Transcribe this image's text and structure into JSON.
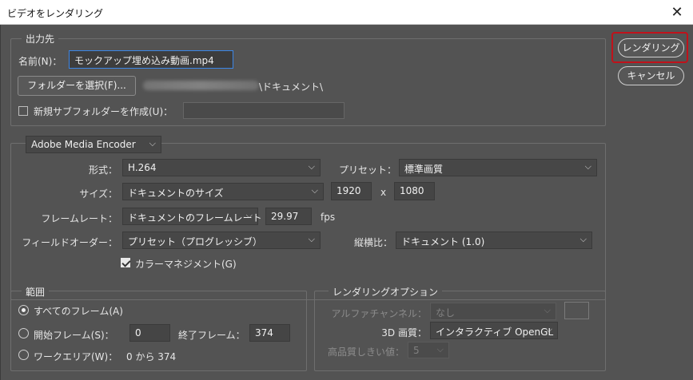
{
  "window": {
    "title": "ビデオをレンダリング",
    "close_glyph": "✕"
  },
  "output": {
    "legend": "出力先",
    "name_label": "名前(N)：",
    "name_value": "モックアップ埋め込み動画.mp4",
    "folder_button": "フォルダーを選択(F)...",
    "folder_path_suffix": "\\ドキュメント\\",
    "subfolder_label": "新規サブフォルダーを作成(U)：",
    "subfolder_checked": false,
    "subfolder_value": ""
  },
  "encoder": {
    "selected": "Adobe Media Encoder",
    "format_label": "形式：",
    "format_value": "H.264",
    "preset_label": "プリセット：",
    "preset_value": "標準画質",
    "size_label": "サイズ：",
    "size_value": "ドキュメントのサイズ",
    "width_value": "1920",
    "x_label": "x",
    "height_value": "1080",
    "framerate_label": "フレームレート：",
    "framerate_value": "ドキュメントのフレームレート",
    "fps_value": "29.97",
    "fps_unit": "fps",
    "field_order_label": "フィールドオーダー：",
    "field_order_value": "プリセット（プログレッシブ）",
    "aspect_label": "縦横比：",
    "aspect_value": "ドキュメント (1.0)",
    "color_mgmt_label": "カラーマネジメント(G)",
    "color_mgmt_checked": true
  },
  "range": {
    "legend": "範囲",
    "all_frames": "すべてのフレーム(A)",
    "start_frame_label": "開始フレーム(S)：",
    "start_frame_value": "0",
    "end_frame_label": "終了フレーム：",
    "end_frame_value": "374",
    "work_area_label": "ワークエリア(W)：",
    "work_area_value": "0 から 374",
    "selected": "all_frames"
  },
  "render_options": {
    "legend": "レンダリングオプション",
    "alpha_label": "アルファチャンネル：",
    "alpha_value": "なし",
    "quality_3d_label": "3D 画質：",
    "quality_3d_value": "インタラクティブ OpenGL",
    "hq_threshold_label": "高品質しきい値：",
    "hq_threshold_value": "5"
  },
  "actions": {
    "render_button": "レンダリング",
    "cancel_button": "キャンセル"
  },
  "colors": {
    "background": "#535353",
    "accent_focus": "#3b86e6",
    "highlight_red": "#c1121a"
  }
}
